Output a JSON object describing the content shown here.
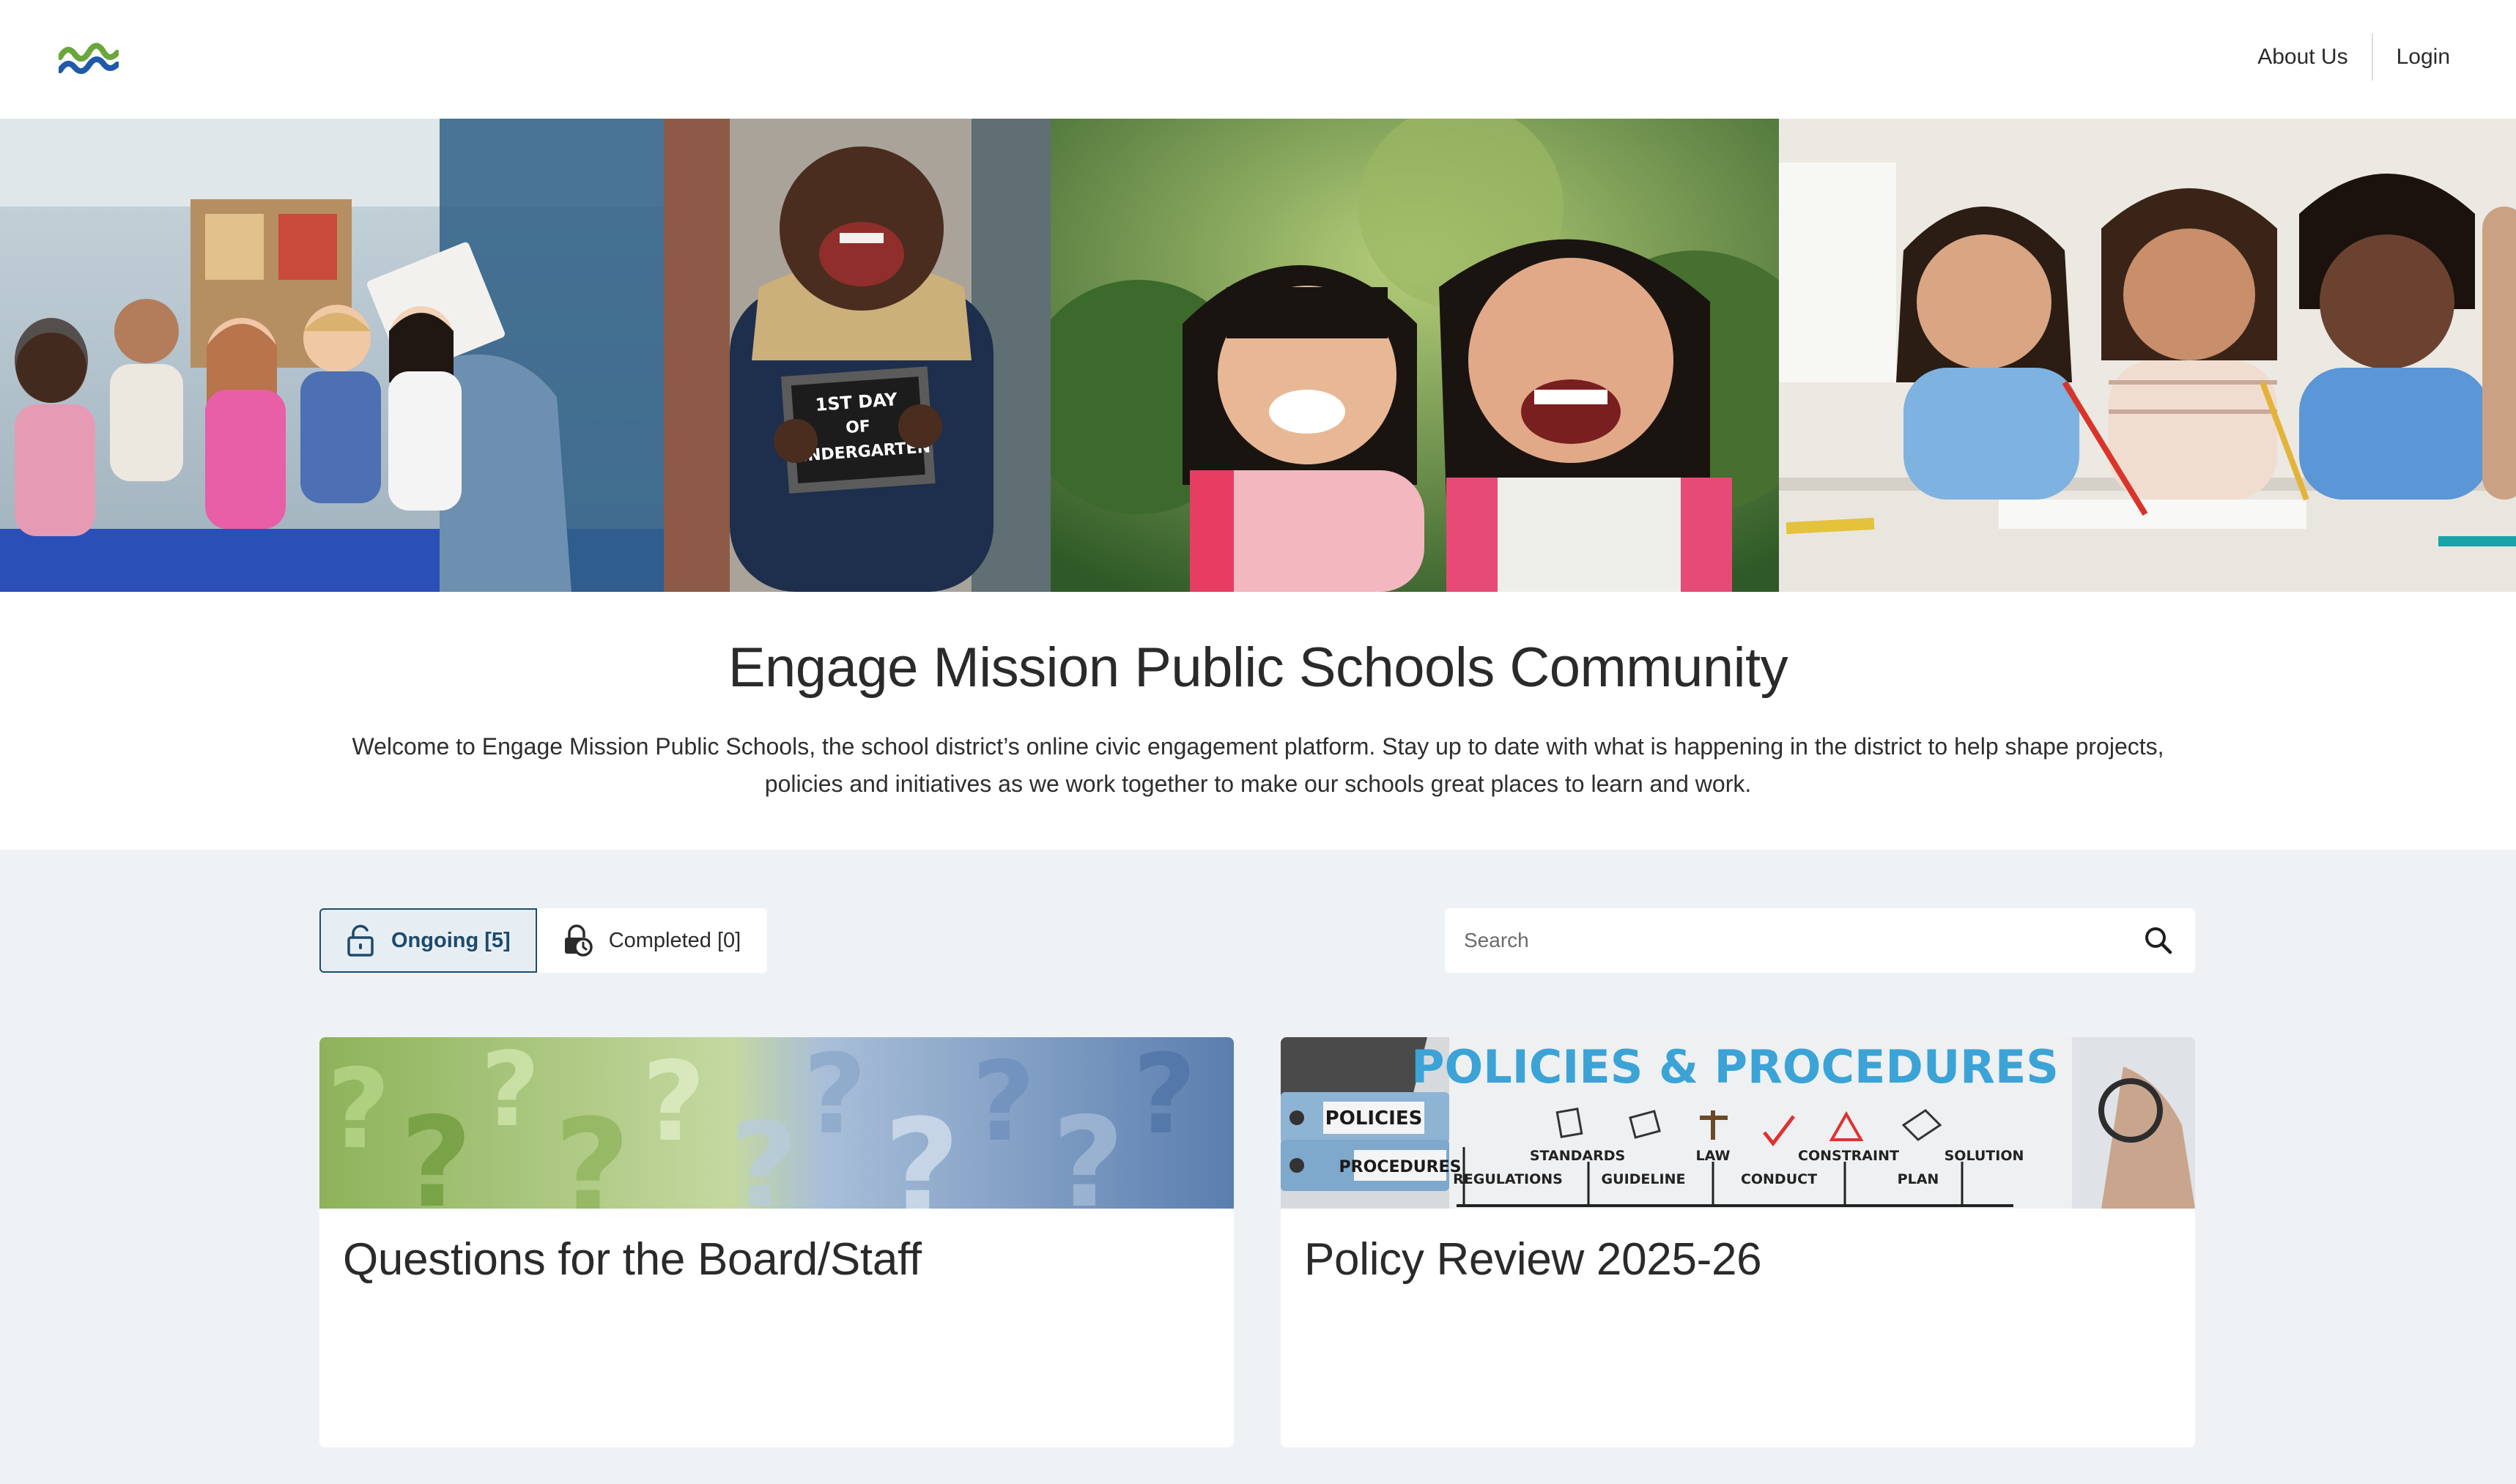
{
  "header": {
    "logo_name": "wave-logo",
    "nav": {
      "about_label": "About Us",
      "login_label": "Login"
    }
  },
  "intro": {
    "title": "Engage Mission Public Schools Community",
    "description": "Welcome to Engage Mission Public Schools, the school district’s online civic engagement platform. Stay up to date with what is happening in the district to help shape projects, policies and initiatives as we work together to make our schools great places to learn and work."
  },
  "filters": {
    "ongoing_label": "Ongoing [5]",
    "completed_label": "Completed [0]"
  },
  "search": {
    "placeholder": "Search"
  },
  "hero": {
    "sign_line1": "1ST DAY",
    "sign_line2": "OF",
    "sign_line3": "KINDERGARTEN"
  },
  "projects": [
    {
      "title": "Questions for the Board/Staff"
    },
    {
      "title": "Policy Review 2025-26",
      "image_text": {
        "headline": "POLICIES & PROCEDURES",
        "binder1": "POLICIES",
        "binder2": "PROCEDURES",
        "terms_top": [
          "STANDARDS",
          "LAW",
          "CONSTRAINT",
          "SOLUTION"
        ],
        "terms_bottom": [
          "REGULATIONS",
          "GUIDELINE",
          "CONDUCT",
          "PLAN"
        ]
      }
    }
  ],
  "colors": {
    "accent_navy": "#1e4c6d",
    "page_bg": "#eef2f5",
    "logo_green": "#6aa63b",
    "logo_blue": "#1f5aa8"
  }
}
